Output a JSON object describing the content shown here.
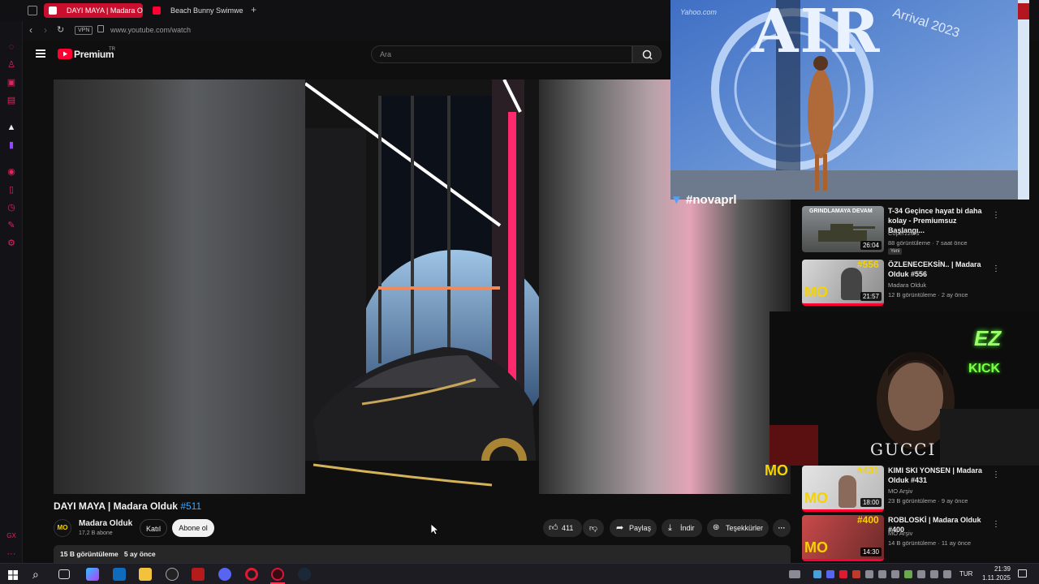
{
  "browser": {
    "tabs": [
      {
        "label": "DAYI MAYA | Madara Olduk",
        "active": true
      },
      {
        "label": "Beach Bunny Swimwear F",
        "active": false
      }
    ],
    "new_tab": "+",
    "vpn_badge": "VPN",
    "url": "www.youtube.com/watch"
  },
  "youtube": {
    "logo_text": "Premium",
    "logo_superscript": "TR",
    "search_placeholder": "Ara",
    "video": {
      "title": "DAYI MAYA | Madara Olduk",
      "title_hashtag": "#511",
      "channel_name": "Madara Olduk",
      "channel_subs": "17,2 B abone",
      "channel_avatar": "MO",
      "join_label": "Katıl",
      "subscribe_label": "Abone ol",
      "likes": "411",
      "share_label": "Paylaş",
      "download_label": "İndir",
      "thanks_label": "Teşekkürler",
      "views_text": "15 B görüntüleme",
      "age_text": "5 ay önce"
    },
    "recommendations": [
      {
        "title": "T-34 Geçince hayat bi daha kolay - Premiumsuz Başlangı...",
        "channel": "Coperzzers",
        "meta": "88 görüntüleme · 7 saat önce",
        "badge": "Yeni",
        "duration": "26:04",
        "thumb_text": "GRINDLAMAYA DEVAM"
      },
      {
        "title": "ÖZLENECEKSİN.. | Madara Olduk #556",
        "channel": "Madara Olduk",
        "meta": "12 B görüntüleme · 2 ay önce",
        "duration": "21:57",
        "thumb_text": "#556"
      },
      {
        "title": "KIMI SKI YONSEN | Madara Olduk #431",
        "channel": "MO Arşiv",
        "meta": "23 B görüntüleme · 9 ay önce",
        "duration": "18:00",
        "thumb_text": "#431"
      },
      {
        "title": "ROBLOSKİ | Madara Olduk #400",
        "channel": "MO Arşiv",
        "meta": "14 B görüntüleme · 11 ay önce",
        "duration": "14:30",
        "thumb_text": "#400"
      }
    ],
    "overlay_thumb_text": "#novaprl"
  },
  "overlays": {
    "top_right_video_text": "AIR",
    "top_right_sub_text": "Arrival 2023",
    "top_right_watermark": "Yahoo.com",
    "webcam_kick_top": "EZ",
    "webcam_kick_bottom": "KICK",
    "webcam_gucci": "GUCCI",
    "webcam_logo": "MO"
  },
  "taskbar": {
    "language": "TUR",
    "time": "21:39",
    "date": "1.11.2025"
  },
  "colors": {
    "accent_red": "#ff0033",
    "opera_red": "#e0245e",
    "bg": "#0f0f0f",
    "hashtag_blue": "#3ea6ff"
  }
}
